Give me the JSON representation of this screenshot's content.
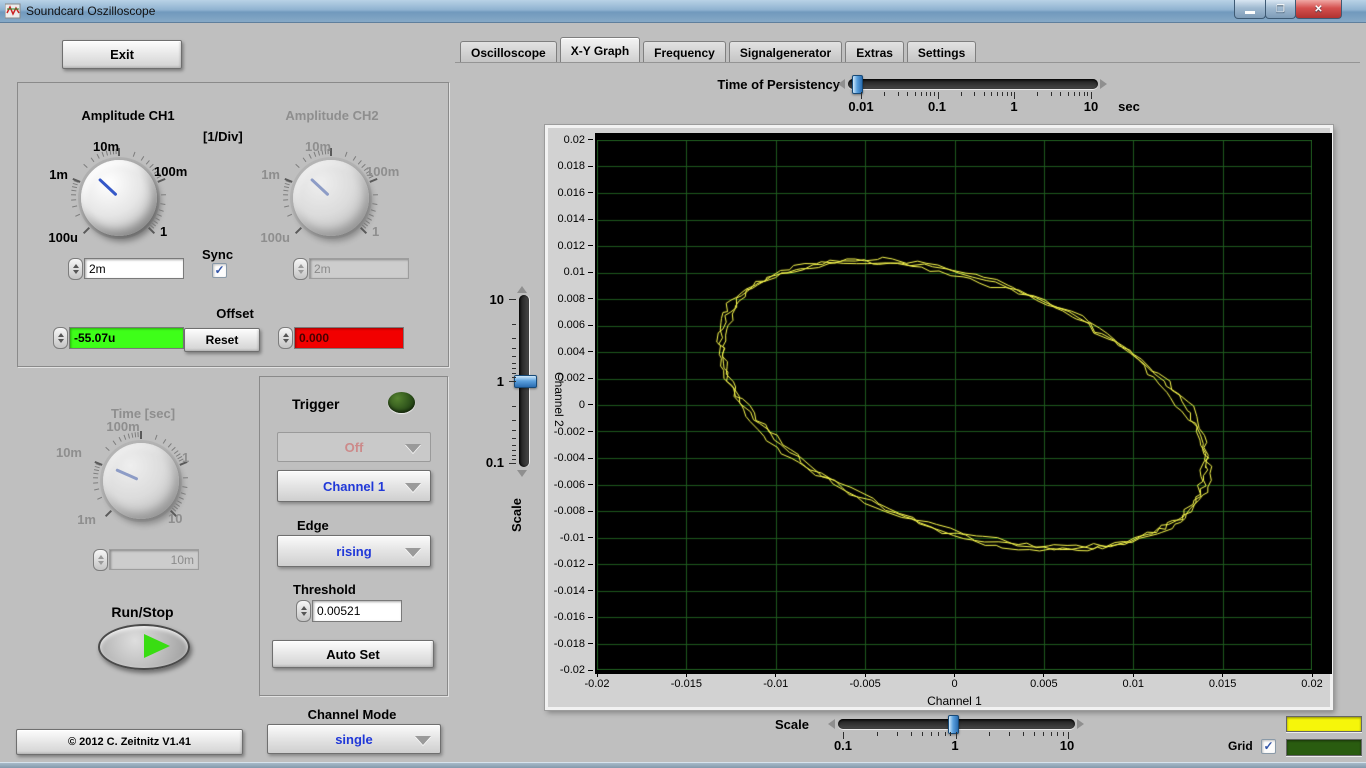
{
  "window": {
    "title": "Soundcard Oszilloscope",
    "minimize": "minimize",
    "restore": "restore",
    "close": "close"
  },
  "tabs": {
    "items": [
      "Oscilloscope",
      "X-Y Graph",
      "Frequency",
      "Signalgenerator",
      "Extras",
      "Settings"
    ],
    "active": "X-Y Graph"
  },
  "left": {
    "exit": "Exit",
    "amplitude": {
      "ch1_title": "Amplitude CH1",
      "unit": "[1/Div]",
      "ch2_title": "Amplitude CH2",
      "knob_labels": {
        "bl": "100u",
        "l": "1m",
        "t": "10m",
        "r": "100m",
        "br": "1"
      },
      "ch1_value": "2m",
      "ch2_value": "2m",
      "ch1_needle_deg": -47,
      "ch2_needle_deg": -47,
      "sync_label": "Sync",
      "sync_checked": true,
      "offset_title": "Offset",
      "offset_ch1": "-55.07u",
      "offset_ch1_color": "#3eff19",
      "reset": "Reset",
      "offset_ch2": "0.000",
      "offset_ch2_color": "#f20000"
    },
    "time": {
      "title": "Time [sec]",
      "knob_labels": {
        "bl": "1m",
        "l": "10m",
        "t": "100m",
        "r": "1",
        "br": "10"
      },
      "value": "10m",
      "needle_deg": -66
    },
    "run_stop": "Run/Stop",
    "copyright": "© 2012   C. Zeitnitz V1.41"
  },
  "trigger": {
    "title": "Trigger",
    "mode": "Off",
    "source": "Channel 1",
    "edge_label": "Edge",
    "edge": "rising",
    "threshold_label": "Threshold",
    "threshold": "0.00521",
    "auto_set": "Auto Set"
  },
  "channel_mode": {
    "label": "Channel Mode",
    "value": "single"
  },
  "persistency": {
    "label": "Time of Persistency",
    "ticks": [
      "0.01",
      "0.1",
      "1",
      "10"
    ],
    "unit": "sec",
    "value": "0.01"
  },
  "graph": {
    "y_label": "Channel 2",
    "x_label": "Channel 1",
    "y_ticks": [
      "0.02",
      "0.018",
      "0.016",
      "0.014",
      "0.012",
      "0.01",
      "0.008",
      "0.006",
      "0.004",
      "0.002",
      "0",
      "-0.002",
      "-0.004",
      "-0.006",
      "-0.008",
      "-0.01",
      "-0.012",
      "-0.014",
      "-0.016",
      "-0.018",
      "-0.02"
    ],
    "x_ticks": [
      "-0.02",
      "-0.015",
      "-0.01",
      "-0.005",
      "0",
      "0.005",
      "0.01",
      "0.015",
      "0.02"
    ]
  },
  "scale_left": {
    "title": "Scale",
    "ticks": [
      "10",
      "1",
      "0.1"
    ],
    "value": "1"
  },
  "scale_bottom": {
    "title": "Scale",
    "ticks": [
      "0.1",
      "1",
      "10"
    ],
    "value": "1"
  },
  "display": {
    "grid_label": "Grid",
    "grid_checked": true,
    "trace_swatch_color": "#f6f60a",
    "grid_swatch_color": "#2a5c10"
  },
  "chart_data": {
    "type": "line",
    "title": "X-Y Graph: Channel 1 vs Channel 2 (Lissajous ellipse)",
    "xlabel": "Channel 1",
    "ylabel": "Channel 2",
    "xlim": [
      -0.02,
      0.02
    ],
    "ylim": [
      -0.02,
      0.02
    ],
    "x_grid_step": 0.005,
    "y_grid_step": 0.002,
    "grid": true,
    "background": "#000000",
    "grid_color": "#1e5a1e",
    "trace_color": "#ffff4f",
    "trace": {
      "shape": "ellipse",
      "center_x": 0.0005,
      "center_y": 0.0,
      "x_amplitude": 0.0135,
      "y_amplitude": 0.0108,
      "phase_deg": 115,
      "cycles": 3,
      "noise_amplitude": 0.0003,
      "x_extent": [
        -0.013,
        0.014
      ],
      "y_extent": [
        -0.011,
        0.011
      ]
    }
  }
}
